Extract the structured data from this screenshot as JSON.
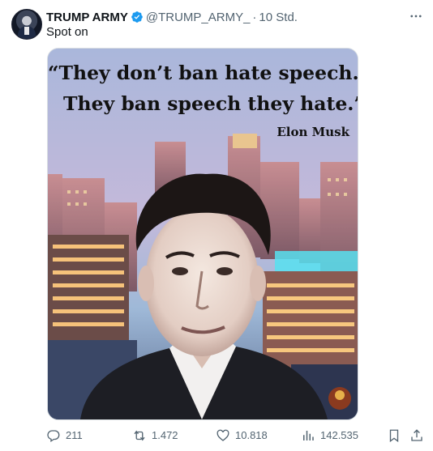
{
  "tweet": {
    "author_name": "TRUMP ARMY",
    "handle": "@TRUMP_ARMY_",
    "separator": "·",
    "time": "10 Std.",
    "text": "Spot on",
    "more": "⋯"
  },
  "media": {
    "quote_line1": "“They don’t ban hate speech.",
    "quote_line2": "They ban speech they hate.”",
    "quote_author": "Elon Musk"
  },
  "actions": {
    "replies": "211",
    "reposts": "1.472",
    "likes": "10.818",
    "views": "142.535"
  },
  "colors": {
    "verified": "#1d9bf0",
    "muted": "#536471",
    "text": "#0f1419"
  },
  "icons": [
    "verified-badge-icon",
    "more-icon",
    "reply-icon",
    "repost-icon",
    "like-icon",
    "views-icon",
    "bookmark-icon",
    "share-icon"
  ]
}
